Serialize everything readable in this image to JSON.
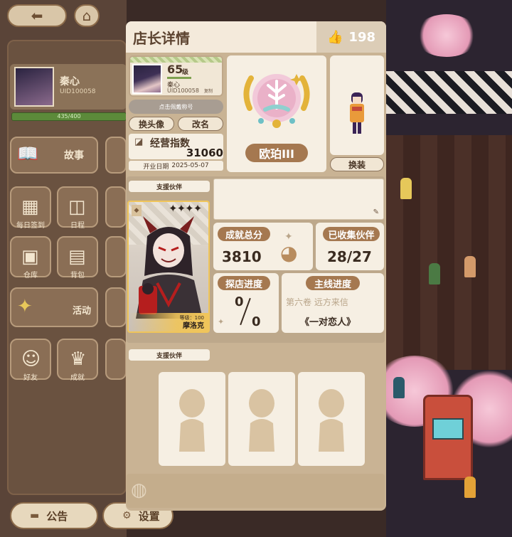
{
  "background": {
    "user_name": "秦心",
    "user_uid": "UID100058",
    "xp_text": "435/400",
    "menu": [
      {
        "label": "故事",
        "icon": "story-book-icon"
      },
      {
        "label": "每日签到",
        "icon": "calendar-icon"
      },
      {
        "label": "日程",
        "icon": "schedule-icon"
      },
      {
        "label": "仓库",
        "icon": "warehouse-icon"
      },
      {
        "label": "背包",
        "icon": "backpack-icon"
      },
      {
        "label": "活动",
        "icon": "activity-icon"
      },
      {
        "label": "好友",
        "icon": "cat-friends-icon"
      },
      {
        "label": "成就",
        "icon": "trophy-icon"
      }
    ],
    "announce_label": "公告",
    "settings_label": "设置"
  },
  "modal": {
    "title": "店长详情",
    "likes": "198",
    "profile": {
      "level": "65",
      "level_unit": "级",
      "name": "秦心",
      "uid": "UID100058",
      "copy_label": "复制"
    },
    "wear_title_label": "点击佩戴称号",
    "change_avatar_label": "换头像",
    "rename_label": "改名",
    "business_index_label": "经营指数",
    "business_index_value": "31060",
    "open_date_label": "开业日期",
    "open_date_value": "2025-05-07",
    "rank_name": "欧珀III",
    "change_outfit_label": "换装",
    "support_partner_label": "支援伙伴",
    "partner": {
      "level_text": "等级：100",
      "name": "摩洛克",
      "stars": "✦✦✦✦"
    },
    "achievement_label": "成就总分",
    "achievement_value": "3810",
    "collected_label": "已收集伙伴",
    "collected_value": "28/27",
    "explore_label": "探店进度",
    "explore_current": "0",
    "explore_total": "0",
    "mainline_label": "主线进度",
    "mainline_chapter": "第六卷 远方来信",
    "mainline_title": "《一对恋人》",
    "support_partner_label_2": "支援伙伴"
  },
  "colors": {
    "accent_brown": "#a57850",
    "panel_beige": "#c9b394",
    "card_cream": "#f6efe3",
    "gold_border": "#f0c55a"
  }
}
